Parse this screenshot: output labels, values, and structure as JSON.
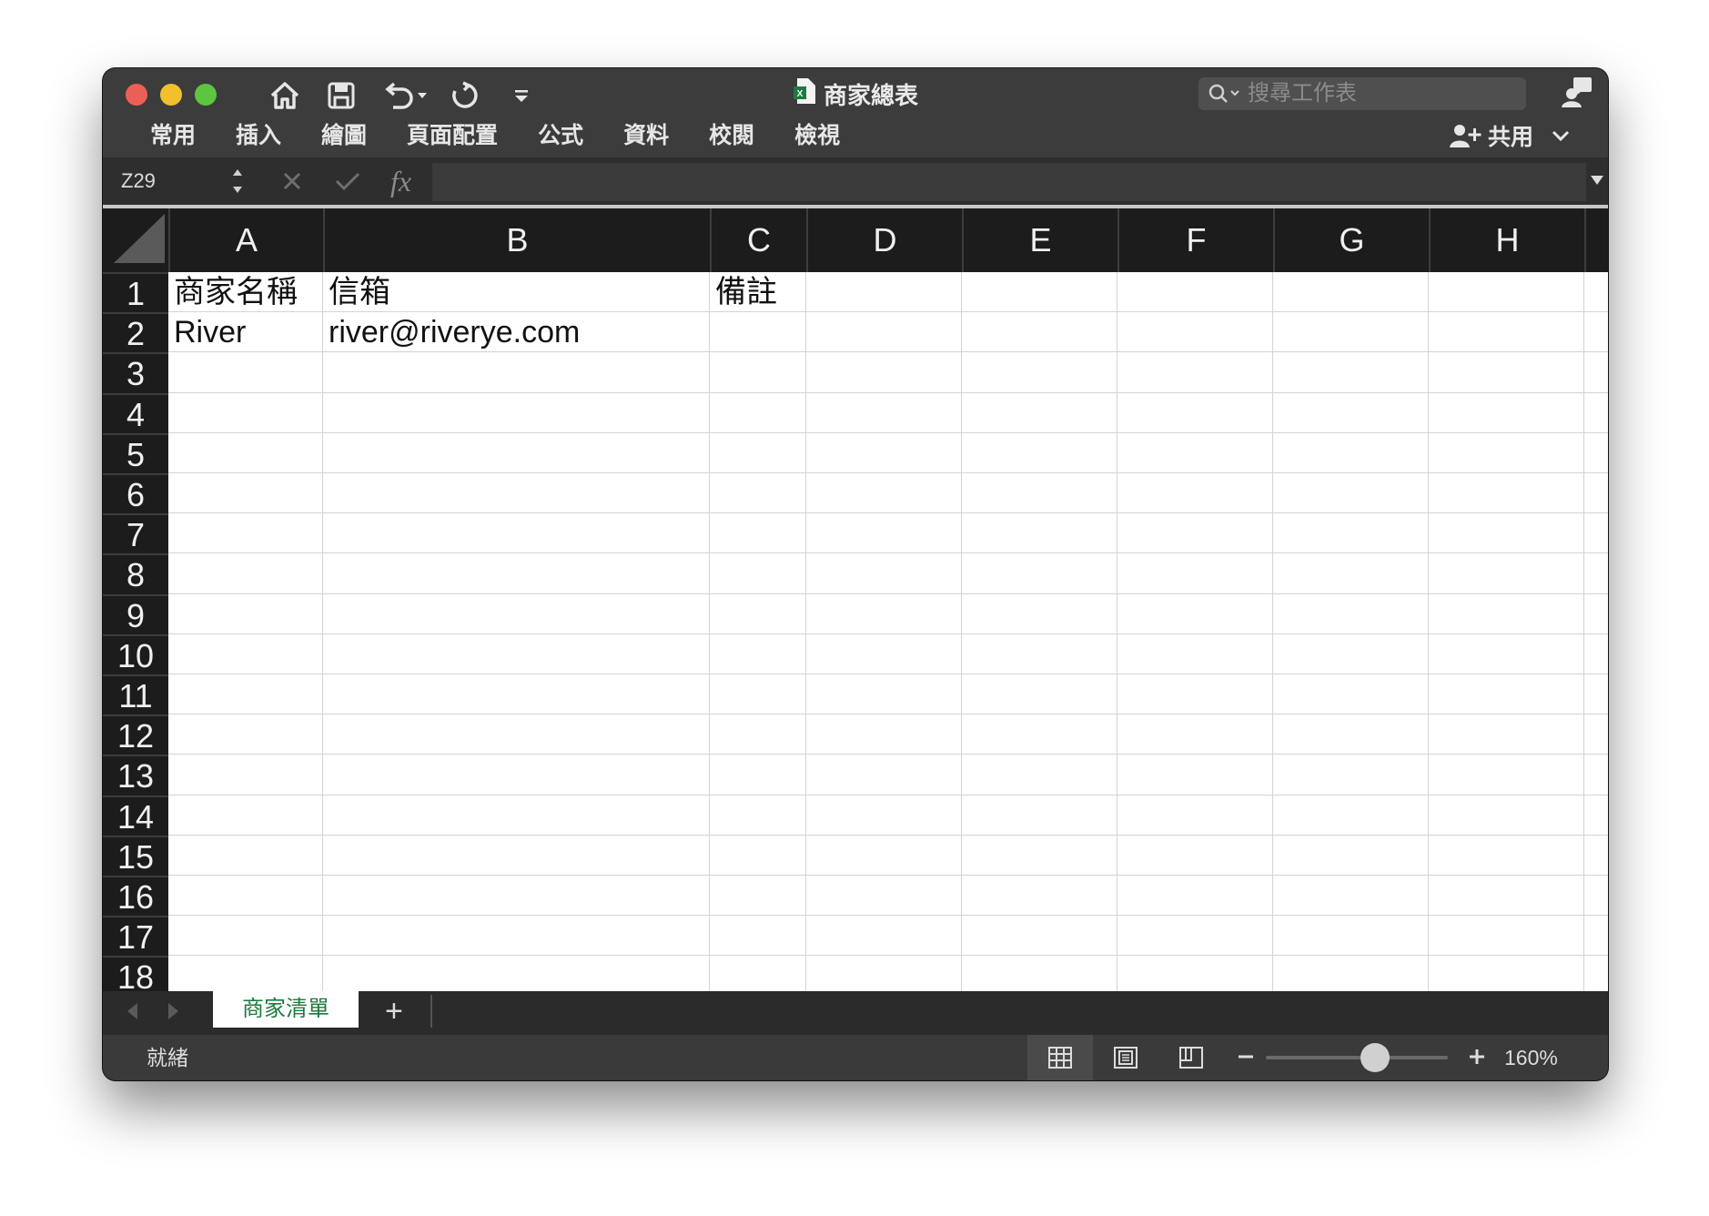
{
  "window": {
    "title": "商家總表"
  },
  "search": {
    "placeholder": "搜尋工作表"
  },
  "ribbon": {
    "tabs": [
      "常用",
      "插入",
      "繪圖",
      "頁面配置",
      "公式",
      "資料",
      "校閱",
      "檢視"
    ],
    "share_label": "共用"
  },
  "formula_bar": {
    "name_box": "Z29",
    "fx_label": "fx",
    "formula": ""
  },
  "sheet": {
    "columns": [
      "A",
      "B",
      "C",
      "D",
      "E",
      "F",
      "G",
      "H"
    ],
    "rows": [
      "1",
      "2",
      "3",
      "4",
      "5",
      "6",
      "7",
      "8",
      "9",
      "10",
      "11",
      "12",
      "13",
      "14",
      "15",
      "16",
      "17",
      "18"
    ],
    "cells": {
      "A1": "商家名稱",
      "B1": "信箱",
      "C1": "備註",
      "A2": "River",
      "B2": "river@riverye.com"
    }
  },
  "sheet_tabs": {
    "active": "商家清單",
    "add_label": "+"
  },
  "status": {
    "text": "就緒",
    "zoom": "160%",
    "zoom_fraction": 0.6
  },
  "colors": {
    "window_bg": "#2f2f2f",
    "header_bg": "#1c1c1c",
    "sheet_tab_text": "#1d7a3e",
    "close": "#ec5f57",
    "minimize": "#f3bf2f",
    "maximize": "#5cc640"
  },
  "icons": {
    "home": "home-icon",
    "save": "save-icon",
    "undo": "undo-icon",
    "redo": "redo-icon",
    "customize": "customize-toolbar-icon",
    "excel": "excel-file-icon",
    "search": "search-icon",
    "account": "account-icon",
    "add_person": "add-person-icon",
    "chevron": "chevron-down-icon"
  }
}
